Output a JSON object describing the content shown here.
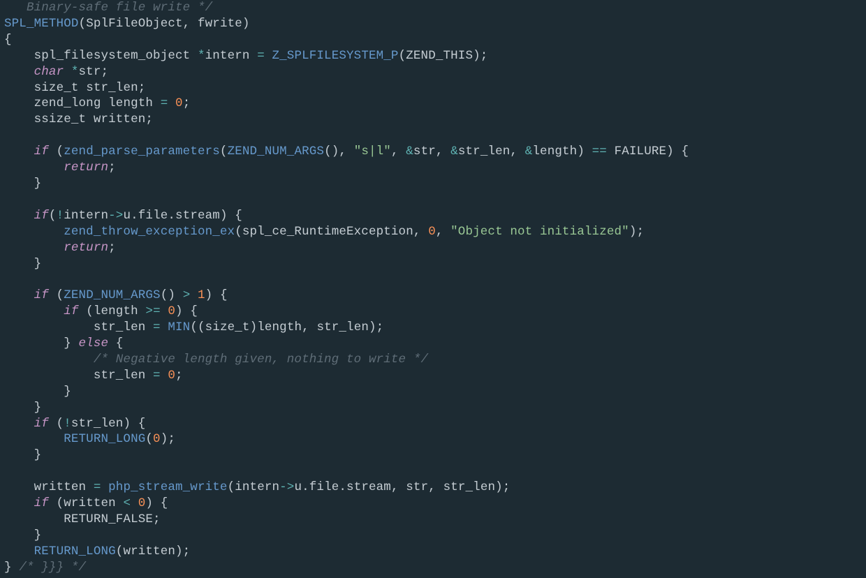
{
  "code": {
    "top_comment_fragment": "   Binary-safe file write */",
    "tokens": {
      "SPL_METHOD": "SPL_METHOD",
      "SplFileObject": "SplFileObject",
      "fwrite": "fwrite",
      "spl_filesystem_object": "spl_filesystem_object",
      "intern": "intern",
      "Z_SPLFILESYSTEM_P": "Z_SPLFILESYSTEM_P",
      "ZEND_THIS": "ZEND_THIS",
      "char": "char",
      "str": "str",
      "size_t": "size_t",
      "str_len": "str_len",
      "zend_long": "zend_long",
      "length": "length",
      "zero": "0",
      "one": "1",
      "ssize_t": "ssize_t",
      "written": "written",
      "if": "if",
      "else": "else",
      "return": "return",
      "zend_parse_parameters": "zend_parse_parameters",
      "ZEND_NUM_ARGS": "ZEND_NUM_ARGS",
      "fmt_sl": "\"s|l\"",
      "FAILURE": "FAILURE",
      "u": "u",
      "file": "file",
      "stream": "stream",
      "zend_throw_exception_ex": "zend_throw_exception_ex",
      "spl_ce_RuntimeException": "spl_ce_RuntimeException",
      "obj_not_init": "\"Object not initialized\"",
      "MIN": "MIN",
      "neg_len_comment": "/* Negative length given, nothing to write */",
      "RETURN_LONG": "RETURN_LONG",
      "RETURN_FALSE": "RETURN_FALSE",
      "php_stream_write": "php_stream_write",
      "end_comment": "/* }}} */"
    }
  }
}
